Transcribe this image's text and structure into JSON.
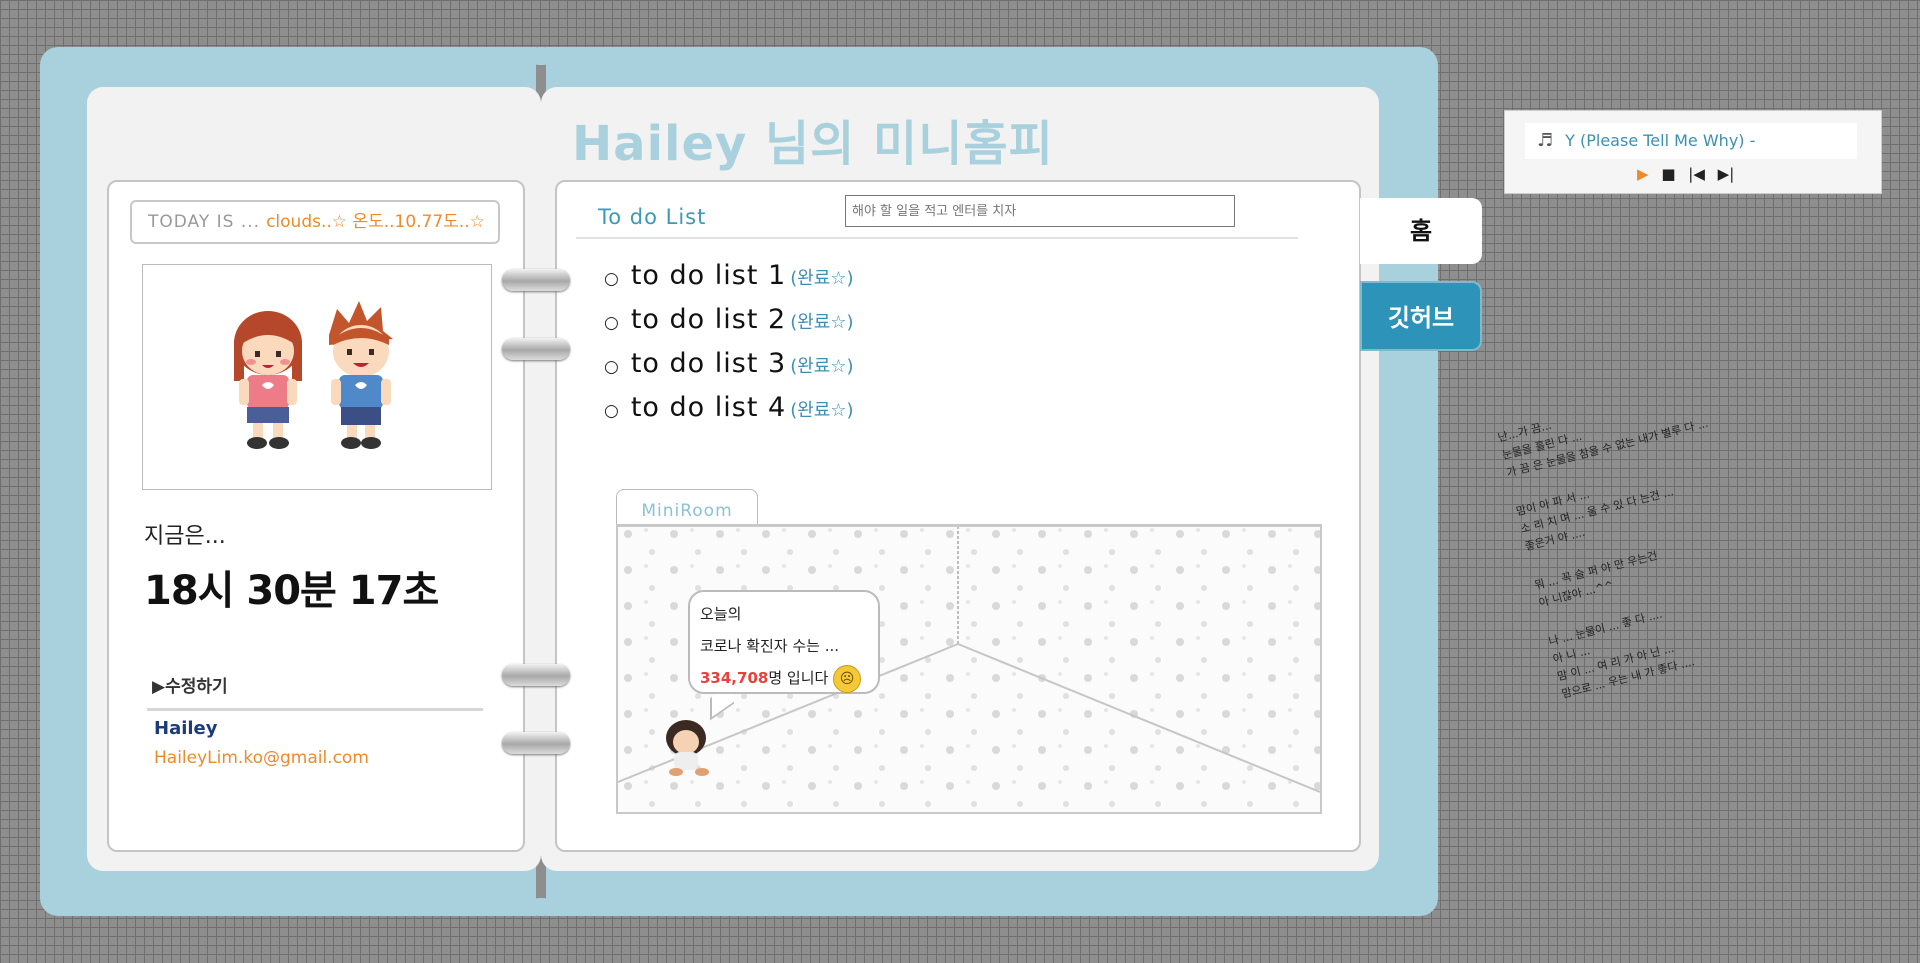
{
  "header": {
    "title": "Hailey 님의 미니홈피"
  },
  "today": {
    "label": "TODAY IS ...",
    "value": "clouds..☆ 온도..10.77도..☆"
  },
  "profile": {
    "now_label": "지금은...",
    "clock": "18시 30분 17초",
    "edit_label": "수정하기",
    "name": "Hailey",
    "email": "HaileyLim.ko@gmail.com"
  },
  "todo": {
    "title": "To do List",
    "input_placeholder": "해야 할 일을 적고 엔터를 치자",
    "items": [
      {
        "text": "to do list 1",
        "done_label": "(완료☆)"
      },
      {
        "text": "to do list 2",
        "done_label": "(완료☆)"
      },
      {
        "text": "to do list 3",
        "done_label": "(완료☆)"
      },
      {
        "text": "to do list 4",
        "done_label": "(완료☆)"
      }
    ]
  },
  "miniroom": {
    "tab_label": "MiniRoom",
    "bubble_line1": "오늘의",
    "bubble_line2": "코로나 확진자 수는 ...",
    "bubble_count": "334,708",
    "bubble_suffix": "명 입니다"
  },
  "nav": {
    "home_label": "홈",
    "github_label": "깃허브"
  },
  "player": {
    "song": "Y (Please Tell Me Why) -"
  },
  "lyrics": [
    [
      "난...가 끔...",
      "눈물을 흘린 다 ...",
      "가 끔 은 눈물을 참을 수 없는 내가 별루 다 ..."
    ],
    [
      "맘이 아 파 서 ...",
      "소 리 치 며 ... 울 수 있 다 는건 ...",
      "좋은거 야 ...."
    ],
    [
      "뭐 ... 꼭 슬 퍼 야 만 우는건",
      "아 니잖아 ...^^"
    ],
    [
      "나 ... 눈물이 ... 좋 다 ....",
      "아 니 ...",
      "맘 이 ... 여 리 가 아 닌 ...",
      "맘으로 ... 우는 내 가 좋다 ...."
    ]
  ],
  "colors": {
    "frame": "#a9d1dd",
    "accent": "#2e93b8",
    "orange": "#f08a28",
    "alert": "#e8413a"
  }
}
